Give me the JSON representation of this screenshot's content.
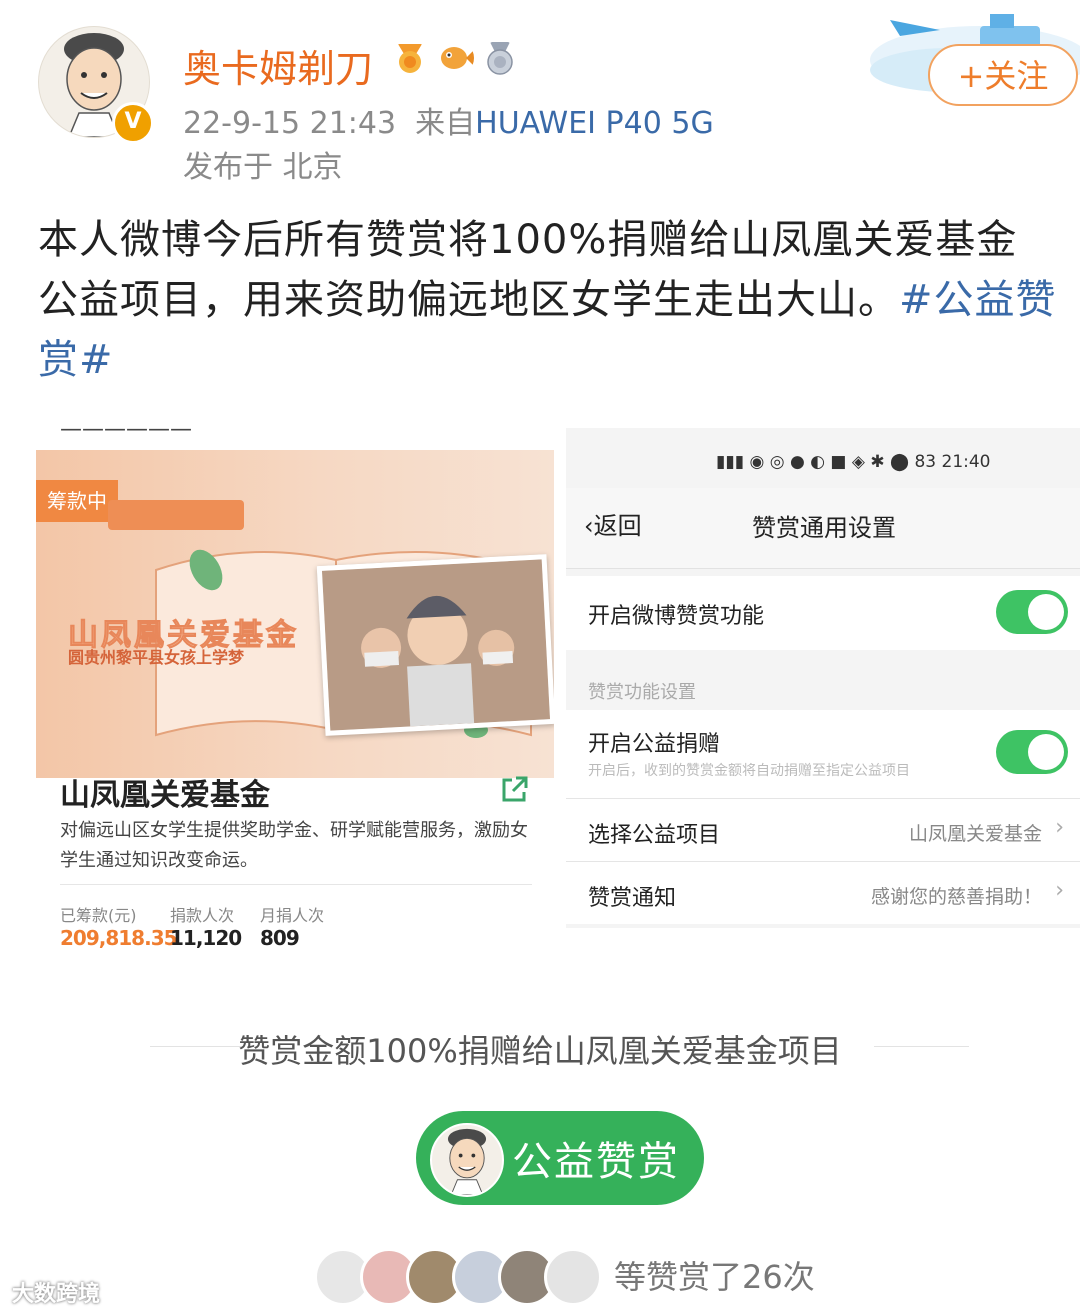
{
  "post": {
    "username": "奥卡姆剃刀",
    "verified_badge": "V",
    "medal_icons": [
      "bronze-medal-icon",
      "fish-badge-icon",
      "silver-medal-icon"
    ],
    "timestamp": "22-9-15 21:43",
    "source_prefix": "来自",
    "device": "HUAWEI P40 5G",
    "location": "发布于 北京",
    "follow_label": "+关注",
    "text": "本人微博今后所有赞赏将100%捐赠给山凤凰关爱基金公益项目，用来资助偏远地区女学生走出大山。",
    "topic": "#公益赞赏#"
  },
  "left_screenshot": {
    "fund_tag": "筹款中",
    "banner_title": "山凤凰关爱基金",
    "banner_subtitle": "圆贵州黎平县女孩上学梦",
    "title": "山凤凰关爱基金",
    "description": "对偏远山区女学生提供奖助学金、研学赋能营服务，激励女学生通过知识改变命运。",
    "stats": [
      {
        "label": "已筹款(元)",
        "value": "209,818.35"
      },
      {
        "label": "捐款人次",
        "value": "11,120"
      },
      {
        "label": "月捐人次",
        "value": "809"
      }
    ],
    "accent_color": "#ef7d30"
  },
  "right_screenshot": {
    "status_time": "21:40",
    "battery": "83",
    "back_label": "返回",
    "title": "赞赏通用设置",
    "rows": [
      {
        "label": "开启微博赞赏功能",
        "toggle": true
      },
      {
        "section": "赞赏功能设置"
      },
      {
        "label": "开启公益捐赠",
        "hint": "开启后，收到的赞赏金额将自动捐赠至指定公益项目",
        "toggle": true
      },
      {
        "label": "选择公益项目",
        "value": "山凤凰关爱基金"
      },
      {
        "label": "赞赏通知",
        "value": "感谢您的慈善捐助！"
      }
    ],
    "toggle_color": "#3ec364"
  },
  "footer": {
    "donate_line": "赞赏金额100%捐赠给山凤凰关爱基金项目",
    "reward_button": "公益赞赏",
    "reward_count": "等赞赏了26次",
    "watermark": "大数跨境"
  }
}
